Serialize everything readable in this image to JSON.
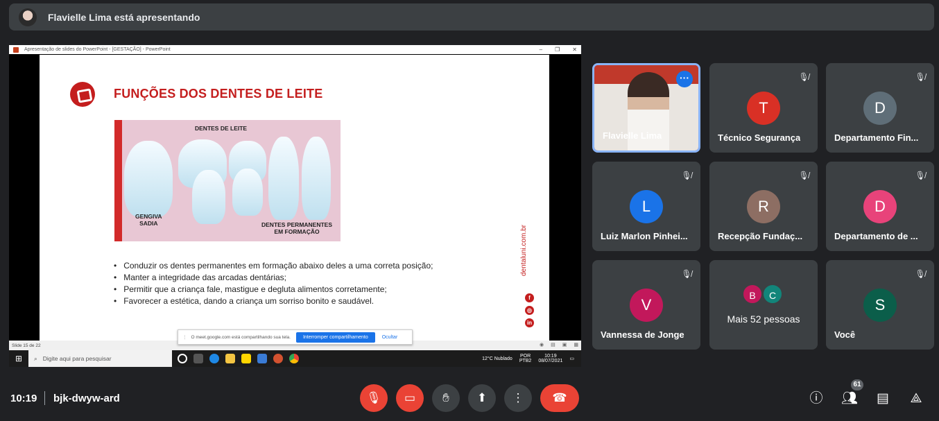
{
  "header": {
    "presenter_text": "Flavielle Lima está apresentando"
  },
  "shared": {
    "window_title": "Apresentação de slides do PowerPoint - [GESTAÇÃO] - PowerPoint",
    "slide_title": "FUNÇÕES DOS DENTES DE LEITE",
    "image_labels": {
      "top": "DENTES DE LEITE",
      "left": "GENGIVA\nSADIA",
      "right": "DENTES PERMANENTES\nEM FORMAÇÃO"
    },
    "bullets": [
      "Conduzir os dentes permanentes em formação abaixo deles a uma correta posição;",
      "Manter a integridade das arcadas dentárias;",
      "Permitir que a criança fale, mastigue e degluta alimentos corretamente;",
      "Favorecer a estética, dando a criança um sorriso bonito e saudável."
    ],
    "vertical_site": "dentaluni.com.br",
    "social": [
      "f",
      "◎",
      "in"
    ],
    "slide_status": "Slide 15 de 22",
    "notice": {
      "text": "O meet.google.com está compartilhando sua tela.",
      "stop_label": "Interromper compartilhamento",
      "hide_label": "Ocultar"
    },
    "taskbar": {
      "search_placeholder": "Digite aqui para pesquisar",
      "weather": "12°C  Nublado",
      "lang": "POR\nPTB2",
      "clock": "10:19\n08/07/2021"
    }
  },
  "participants": [
    {
      "name": "Flavielle Lima",
      "featured": true
    },
    {
      "name": "Técnico Segurança",
      "initial": "T",
      "color": "#d93025"
    },
    {
      "name": "Departamento Fin...",
      "initial": "D",
      "color": "#5f6e78"
    },
    {
      "name": "Luiz Marlon Pinhei...",
      "initial": "L",
      "color": "#1a73e8"
    },
    {
      "name": "Recepção Fundaç...",
      "initial": "R",
      "color": "#8d6e63"
    },
    {
      "name": "Departamento de ...",
      "initial": "D",
      "color": "#e8437a"
    },
    {
      "name": "Vannessa de Jonge",
      "initial": "V",
      "color": "#c2185b"
    },
    {
      "name": "Mais 52 pessoas",
      "initials": [
        "B",
        "C"
      ],
      "colors": [
        "#c2185b",
        "#12857a"
      ]
    },
    {
      "name": "Você",
      "initial": "S",
      "color": "#0b5e4a"
    }
  ],
  "bottom": {
    "time": "10:19",
    "meeting_code": "bjk-dwyw-ard",
    "participant_count": "61"
  }
}
